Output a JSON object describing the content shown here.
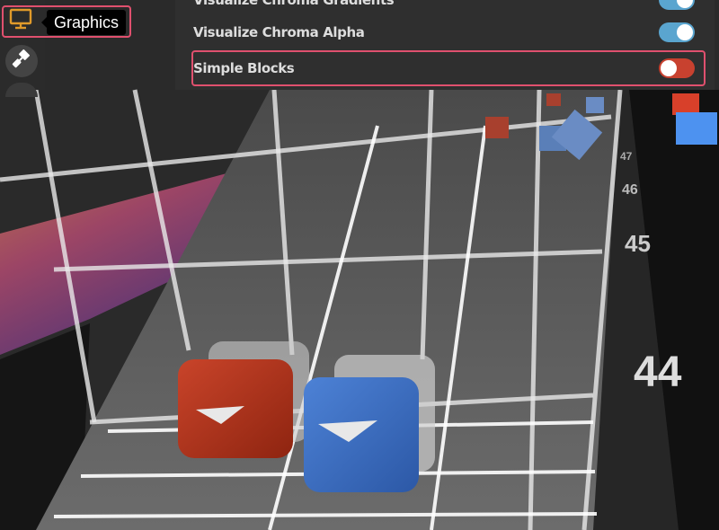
{
  "sidebar": {
    "active_item": {
      "icon": "monitor-icon",
      "tooltip": "Graphics"
    },
    "items": [
      {
        "icon": "paint-brush-icon"
      }
    ]
  },
  "settings": {
    "partial_row": {
      "label": "Visualize Chroma Gradients",
      "value": true
    },
    "rows": [
      {
        "label": "Visualize Chroma Alpha",
        "value": true
      },
      {
        "label": "Simple Blocks",
        "value": false
      }
    ]
  },
  "lane_numbers": [
    "47",
    "46",
    "45",
    "44"
  ],
  "colors": {
    "highlight": "#e0506e",
    "toggle_on": "#5aa5cf",
    "toggle_off": "#c8412f",
    "red_block": "#b8321c",
    "blue_block": "#3d6fc2",
    "icon_orange": "#e09a2a"
  }
}
